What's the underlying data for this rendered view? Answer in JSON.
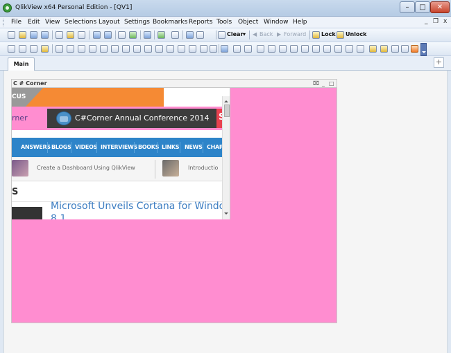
{
  "window": {
    "title": "QlikView x64 Personal Edition - [QV1]",
    "min": "–",
    "max": "□",
    "close": "✕"
  },
  "menu": {
    "items": [
      "File",
      "Edit",
      "View",
      "Selections",
      "Layout",
      "Settings",
      "Bookmarks",
      "Reports",
      "Tools",
      "Object",
      "Window",
      "Help"
    ],
    "doc_min": "_",
    "doc_restore": "❐",
    "doc_close": "x"
  },
  "toolbar": {
    "clear": "Clear",
    "back": "Back",
    "forward": "Forward",
    "lock": "Lock",
    "unlock": "Unlock"
  },
  "tabs": [
    {
      "label": "Main"
    }
  ],
  "add_tab": "+",
  "web_object": {
    "caption": "C # Corner",
    "caption_controls": {
      "xl": "⌧",
      "min": "_",
      "max": "□"
    },
    "banner_text": "CUS",
    "corner_text": "rner",
    "conference_title": "C#Corner Annual Conference 2014",
    "conference_badge": "S",
    "nav": [
      "ANSWERS",
      "BLOGS",
      "VIDEOS",
      "INTERVIEWS",
      "BOOKS",
      "LINKS",
      "NEWS",
      "CHAPT"
    ],
    "articles": [
      "Create a Dashboard Using QlikView",
      "Introductio"
    ],
    "section_letter": "S",
    "news_headline": "Microsoft Unveils Cortana for Windo",
    "news_headline_2": "8.1",
    "hscroll_grip": "|||"
  },
  "colors": {
    "object_background": "#ff8dd0",
    "banner_orange": "#f58a34",
    "nav_blue": "#2d84c9",
    "headline_blue": "#3b7cc1"
  }
}
